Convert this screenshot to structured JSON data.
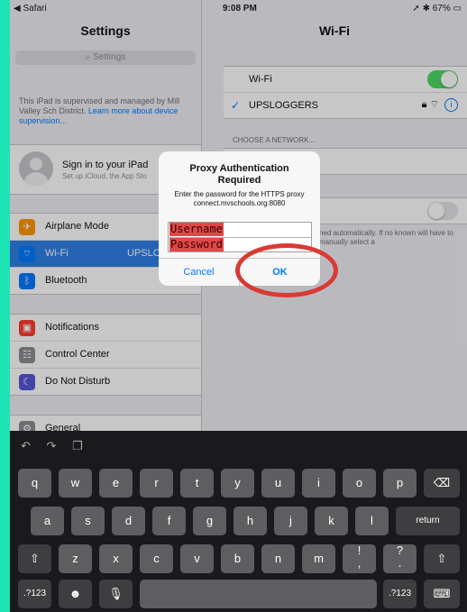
{
  "status_bar": {
    "left": "Safari",
    "time": "9:08 PM",
    "right": "67%"
  },
  "master": {
    "title": "Settings",
    "search_placeholder": "Settings",
    "supervised_text": "This iPad is supervised and managed by Mill Valley Sch District.",
    "supervised_link": "Learn more about device supervision...",
    "signin_title": "Sign in to your iPad",
    "signin_sub": "Set up iCloud, the App Sto",
    "rows_group1": [
      {
        "label": "Airplane Mode",
        "value": "",
        "icon": "airplane-icon",
        "color": "#ff9500"
      },
      {
        "label": "Wi-Fi",
        "value": "UPSLO",
        "icon": "wifi-icon",
        "color": "#007aff"
      },
      {
        "label": "Bluetooth",
        "value": "",
        "icon": "bluetooth-icon",
        "color": "#007aff"
      }
    ],
    "rows_group2": [
      {
        "label": "Notifications",
        "icon": "notifications-icon",
        "color": "#ff3b30"
      },
      {
        "label": "Control Center",
        "icon": "control-center-icon",
        "color": "#8e8e93"
      },
      {
        "label": "Do Not Disturb",
        "icon": "moon-icon",
        "color": "#5856d6"
      }
    ],
    "rows_group3": [
      {
        "label": "General",
        "icon": "gear-icon",
        "color": "#8e8e93"
      }
    ]
  },
  "detail": {
    "title": "Wi-Fi",
    "wifi_label": "Wi-Fi",
    "network_name": "UPSLOGGERS",
    "choose_header": "CHOOSE A NETWORK...",
    "footnote": "ned automatically. If no known  will have to manually select a"
  },
  "dialog": {
    "title": "Proxy Authentication Required",
    "message": "Enter the password for the HTTPS proxy connect.mvschools.org:8080",
    "username_placeholder": "Username",
    "password_placeholder": "Password",
    "cancel": "Cancel",
    "ok": "OK"
  },
  "keyboard": {
    "row1": [
      "q",
      "w",
      "e",
      "r",
      "t",
      "y",
      "u",
      "i",
      "o",
      "p"
    ],
    "row2": [
      "a",
      "s",
      "d",
      "f",
      "g",
      "h",
      "j",
      "k",
      "l"
    ],
    "row3": [
      "z",
      "x",
      "c",
      "v",
      "b",
      "n",
      "m",
      "!",
      ",",
      "?",
      "."
    ],
    "return": "return",
    "num": ".?123"
  },
  "colors": {
    "annotation": "#d83a34",
    "accent": "#007aff",
    "frame": "#1ee3b5"
  }
}
